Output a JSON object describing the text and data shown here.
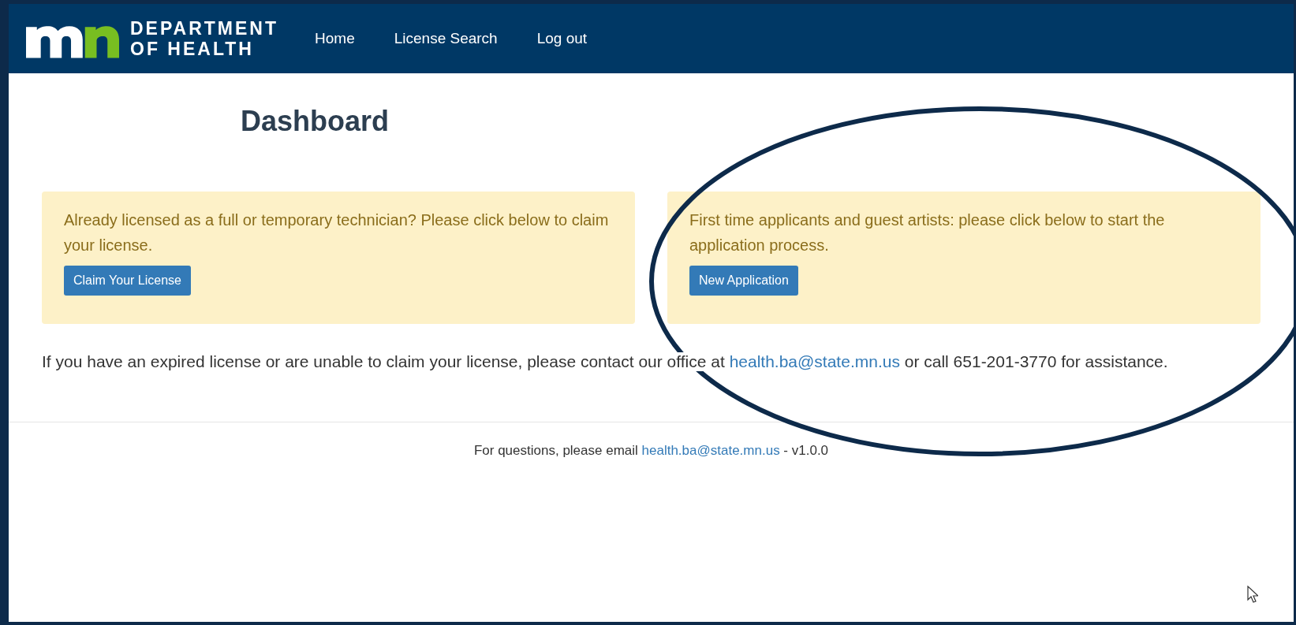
{
  "header": {
    "brand_lines": [
      "DEPARTMENT",
      "OF HEALTH"
    ],
    "nav": [
      "Home",
      "License Search",
      "Log out"
    ]
  },
  "title": "Dashboard",
  "panels": [
    {
      "text": "Already licensed as a full or temporary technician? Please click below to claim your license.",
      "button": "Claim Your License"
    },
    {
      "text": "First time applicants and guest artists: please click below to start the application process.",
      "button": "New Application"
    }
  ],
  "notice": {
    "before": "If you have an expired license or are unable to claim your license, please contact our office at ",
    "link": "health.ba@state.mn.us",
    "after": " or call 651-201-3770 for assistance."
  },
  "footer": {
    "before": "For questions, please email ",
    "link": "health.ba@state.mn.us",
    "after": " - v1.0.0"
  }
}
